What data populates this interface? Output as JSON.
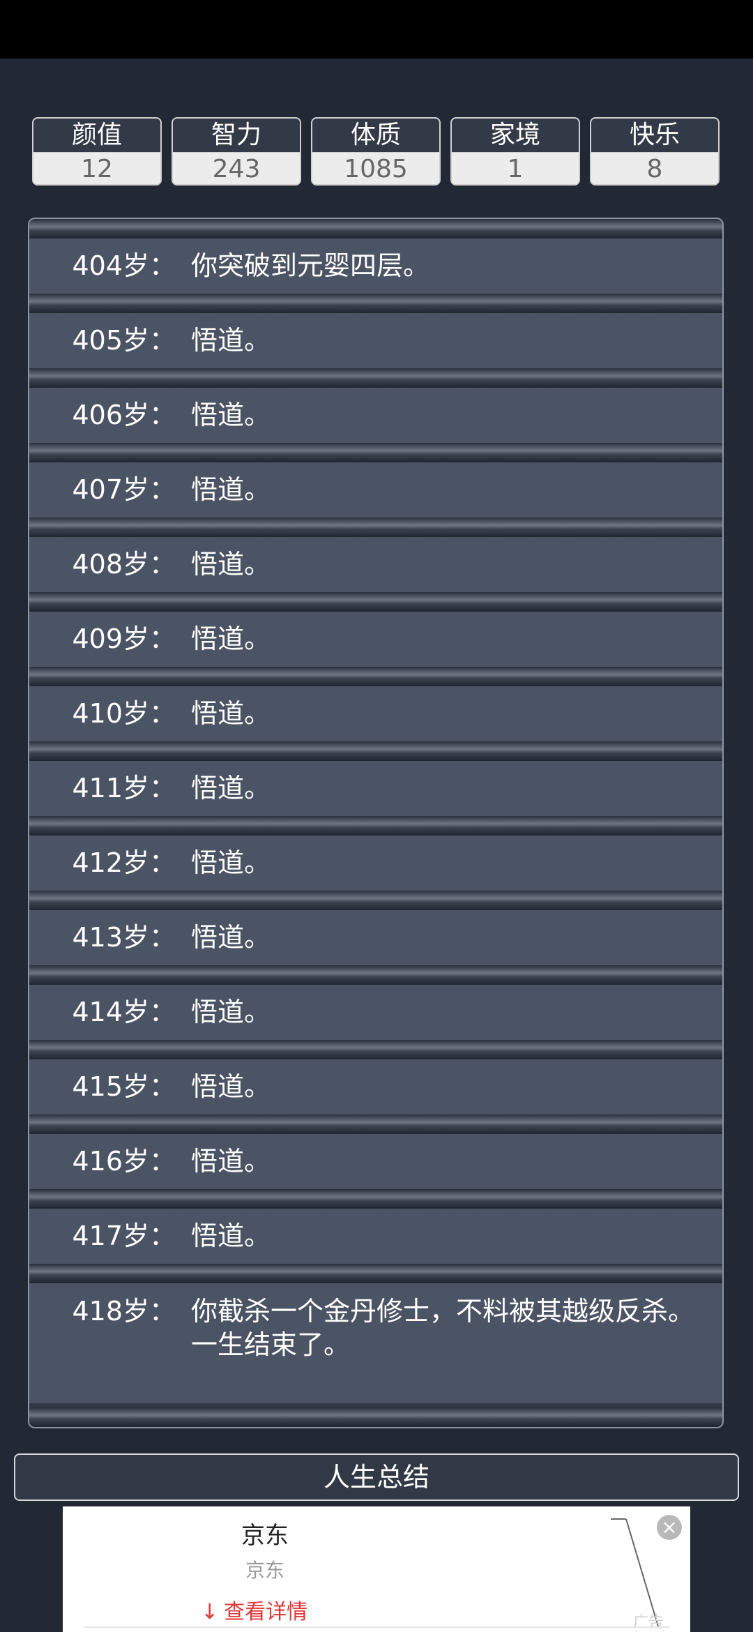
{
  "stats": [
    {
      "label": "颜值",
      "value": "12"
    },
    {
      "label": "智力",
      "value": "243"
    },
    {
      "label": "体质",
      "value": "1085"
    },
    {
      "label": "家境",
      "value": "1"
    },
    {
      "label": "快乐",
      "value": "8"
    }
  ],
  "log": [
    {
      "age": "404岁：",
      "event": "你突破到元婴四层。"
    },
    {
      "age": "405岁：",
      "event": "悟道。"
    },
    {
      "age": "406岁：",
      "event": "悟道。"
    },
    {
      "age": "407岁：",
      "event": "悟道。"
    },
    {
      "age": "408岁：",
      "event": "悟道。"
    },
    {
      "age": "409岁：",
      "event": "悟道。"
    },
    {
      "age": "410岁：",
      "event": "悟道。"
    },
    {
      "age": "411岁：",
      "event": "悟道。"
    },
    {
      "age": "412岁：",
      "event": "悟道。"
    },
    {
      "age": "413岁：",
      "event": "悟道。"
    },
    {
      "age": "414岁：",
      "event": "悟道。"
    },
    {
      "age": "415岁：",
      "event": "悟道。"
    },
    {
      "age": "416岁：",
      "event": "悟道。"
    },
    {
      "age": "417岁：",
      "event": "悟道。"
    },
    {
      "age": "418岁：",
      "event": "你截杀一个金丹修士，不料被其越级反杀。",
      "event2": "一生结束了。"
    }
  ],
  "summary_button": "人生总结",
  "ad": {
    "title": "京东",
    "subtitle": "京东",
    "cta": "查看详情",
    "tag": "广告"
  }
}
